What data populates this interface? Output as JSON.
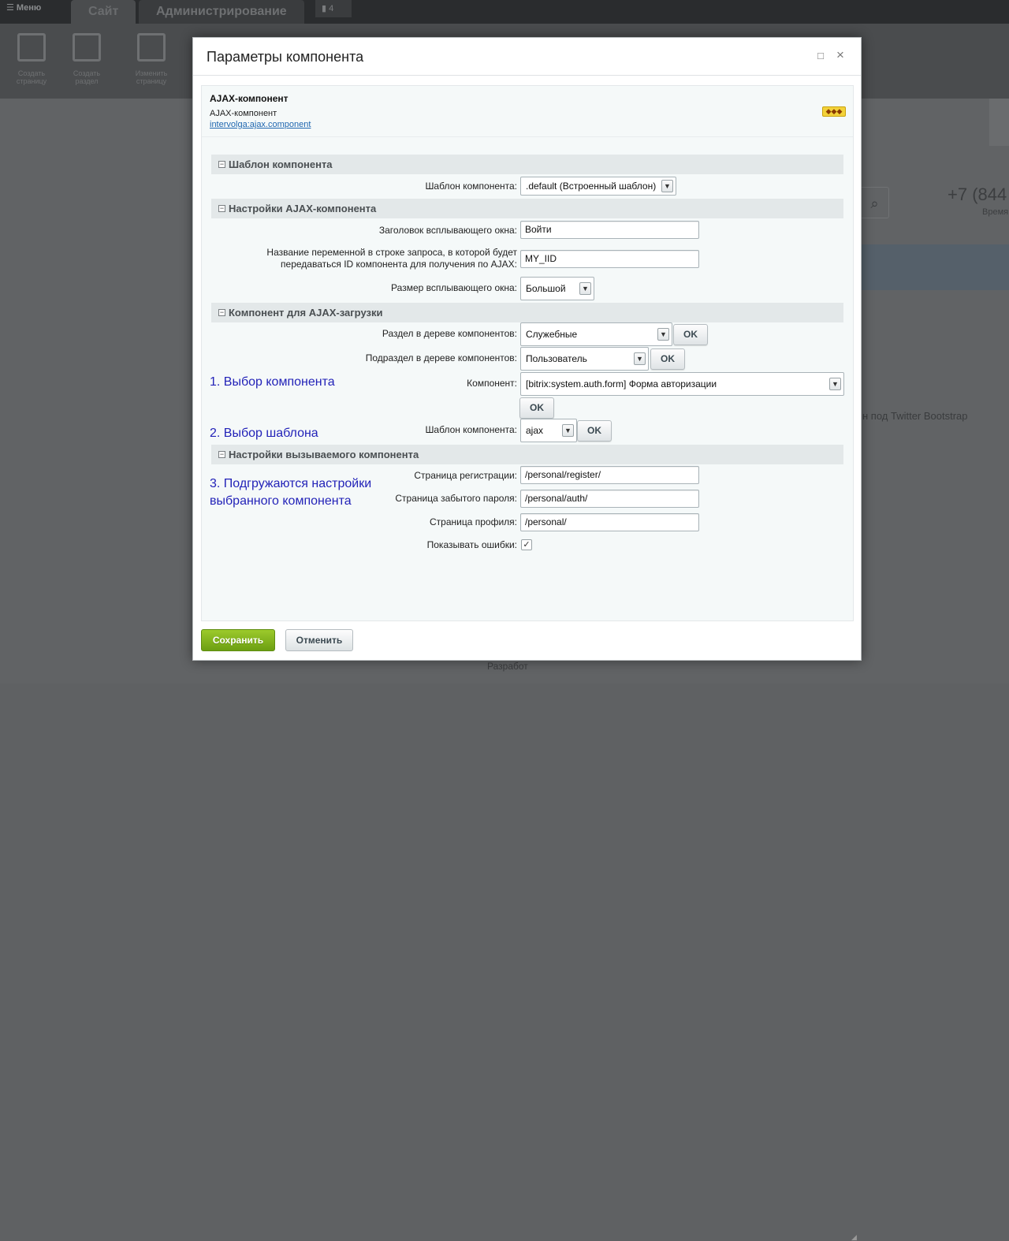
{
  "background": {
    "menu_label": "Меню",
    "tabs": [
      "Сайт",
      "Администрирование"
    ],
    "notifications_count": "4",
    "toolbar": [
      {
        "label": "Создать страницу",
        "icon": "new-page-icon"
      },
      {
        "label": "Создать раздел",
        "icon": "new-folder-icon"
      },
      {
        "label": "Изменить страницу",
        "icon": "edit-page-icon"
      }
    ],
    "phone": "+7 (844",
    "time_label": "Время",
    "twitter_text": "н под Twitter Bootstrap",
    "footer_text": "Разработ"
  },
  "dialog": {
    "title": "Параметры компонента",
    "component": {
      "name": "AJAX-компонент",
      "description": "AJAX-компонент",
      "code": "intervolga:ajax.component"
    },
    "sections": [
      {
        "label": "Шаблон компонента"
      },
      {
        "label": "Настройки AJAX-компонента"
      },
      {
        "label": "Компонент для AJAX-загрузки"
      },
      {
        "label": "Настройки вызываемого компонента"
      }
    ],
    "fields": {
      "template_label": "Шаблон компонента:",
      "template_value": ".default (Встроенный шаблон)",
      "popup_title_label": "Заголовок всплывающего окна:",
      "popup_title_value": "Войти",
      "var_name_label": "Название переменной в строке запроса, в которой будет передаваться ID компонента для получения по AJAX:",
      "var_name_value": "MY_IID",
      "popup_size_label": "Размер всплывающего окна:",
      "popup_size_value": "Большой",
      "tree_section_label": "Раздел в дереве компонентов:",
      "tree_section_value": "Служебные",
      "tree_subsection_label": "Подраздел в дереве компонентов:",
      "tree_subsection_value": "Пользователь",
      "component_label": "Компонент:",
      "component_value": "[bitrix:system.auth.form] Форма авторизации",
      "comp_template_label": "Шаблон компонента:",
      "comp_template_value": "ajax",
      "register_label": "Страница регистрации:",
      "register_value": "/personal/register/",
      "forgot_label": "Страница забытого пароля:",
      "forgot_value": "/personal/auth/",
      "profile_label": "Страница профиля:",
      "profile_value": "/personal/",
      "show_errors_label": "Показывать ошибки:",
      "show_errors_checked": true
    },
    "ok_label": "OK",
    "annotations": {
      "step1": "1. Выбор компонента",
      "step2": "2. Выбор шаблона",
      "step3_line1": "3. Подгружаются настройки",
      "step3_line2": "выбранного компонента"
    },
    "buttons": {
      "save": "Сохранить",
      "cancel": "Отменить"
    }
  }
}
